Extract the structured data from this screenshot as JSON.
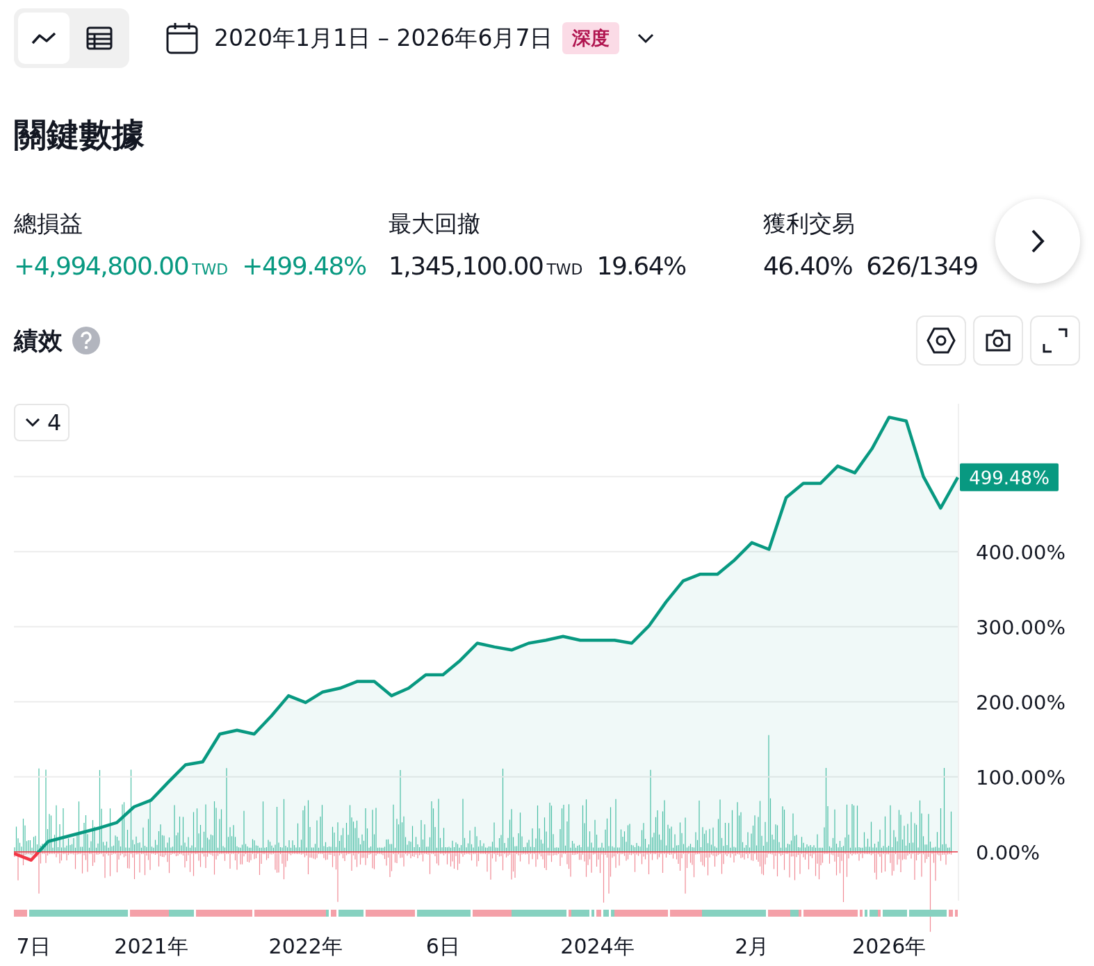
{
  "toolbar": {
    "view_toggle": [
      {
        "kind": "chart",
        "selected": true
      },
      {
        "kind": "table",
        "selected": false
      }
    ],
    "date_range": "2020年1月1日 – 2026年6月7日",
    "badge": "深度"
  },
  "heading": "關鍵數據",
  "metrics": [
    {
      "label": "總損益",
      "value": "+4,994,800.00",
      "unit": "TWD",
      "secondary": "+499.48%",
      "positive": true
    },
    {
      "label": "最大回撤",
      "value": "1,345,100.00",
      "unit": "TWD",
      "secondary": "19.64%",
      "positive": false
    },
    {
      "label": "獲利交易",
      "value": "46.40%",
      "secondary": "626/1349",
      "positive": false
    }
  ],
  "performance": {
    "title": "績效",
    "legend_count": "4",
    "last_value_badge": "499.48%",
    "chart_data": {
      "type": "area",
      "grid": true,
      "ylim": [
        -65,
        597
      ],
      "categories": [
        null,
        "7日",
        null,
        null,
        null,
        null,
        null,
        null,
        "2021年",
        null,
        null,
        null,
        null,
        null,
        null,
        null,
        null,
        "2022年",
        null,
        null,
        null,
        null,
        null,
        null,
        null,
        "6日",
        null,
        null,
        null,
        null,
        null,
        null,
        null,
        null,
        "2024年",
        null,
        null,
        null,
        null,
        null,
        null,
        null,
        null,
        "2月",
        null,
        null,
        null,
        null,
        null,
        null,
        null,
        "2026年",
        null,
        null,
        null,
        null
      ],
      "series": [
        {
          "color": "#089981",
          "values": [
            -2,
            -11,
            14,
            20,
            26,
            32,
            39,
            60,
            69,
            93,
            116,
            120,
            157,
            162,
            157,
            181,
            208,
            199,
            213,
            218,
            227,
            227,
            208,
            218,
            236,
            236,
            255,
            278,
            273,
            269,
            278,
            282,
            287,
            282,
            282,
            282,
            278,
            301,
            333,
            361,
            370,
            370,
            389,
            412,
            403,
            472,
            491,
            491,
            514,
            505,
            537,
            579,
            574,
            500,
            458,
            499
          ]
        }
      ],
      "yticks": [
        {
          "value": 0,
          "label": "0.00%"
        },
        {
          "value": 100,
          "label": "100.00%"
        },
        {
          "value": 200,
          "label": "200.00%"
        },
        {
          "value": 300,
          "label": "300.00%"
        },
        {
          "value": 400,
          "label": "400.00%"
        }
      ]
    }
  }
}
